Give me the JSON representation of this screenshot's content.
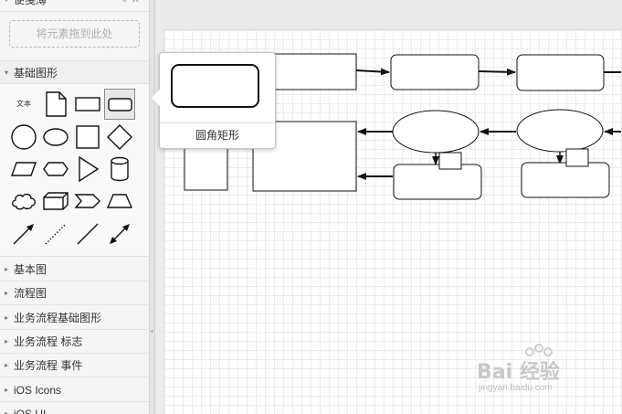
{
  "sidebar": {
    "scratchpad": {
      "title": "便笺薄",
      "drop_hint": "将元素拖到此处"
    },
    "basic_shapes": {
      "title": "基础图形",
      "text_shape_label": "文本",
      "shapes": [
        "text",
        "document",
        "rectangle",
        "rounded-rectangle",
        "circle",
        "ellipse",
        "square",
        "diamond",
        "parallelogram",
        "hexagon",
        "triangle",
        "cylinder",
        "cloud",
        "cube",
        "step",
        "trapezoid",
        "arrow",
        "dotted-line",
        "line",
        "bidirectional-arrow"
      ],
      "selected_shape": "rounded-rectangle"
    },
    "categories": [
      {
        "label": "基本图"
      },
      {
        "label": "流程图"
      },
      {
        "label": "业务流程基础图形"
      },
      {
        "label": "业务流程 标志"
      },
      {
        "label": "业务流程 事件"
      },
      {
        "label": "iOS Icons"
      },
      {
        "label": "iOS UI"
      }
    ]
  },
  "tooltip": {
    "label": "圆角矩形"
  },
  "watermark": {
    "brand": "Bai 经验",
    "url": "jingyan.baidu.com"
  },
  "colors": {
    "grid": "#ececec",
    "sidebar_bg": "#f5f5f5",
    "stroke": "#111111"
  }
}
